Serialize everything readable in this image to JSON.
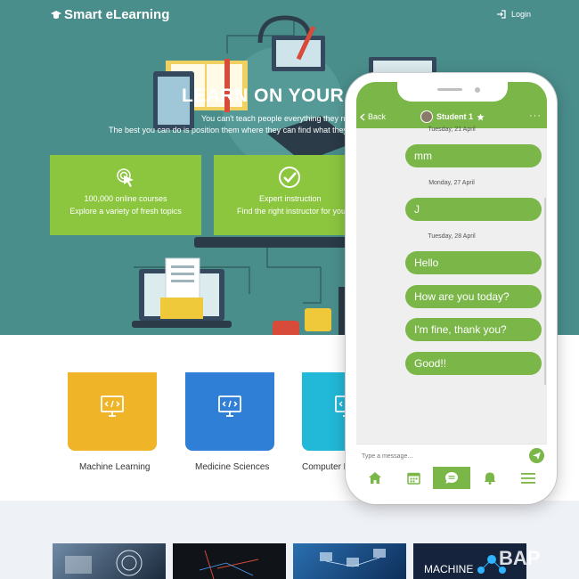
{
  "brand": {
    "name": "Smart eLearning"
  },
  "header": {
    "login_label": "Login"
  },
  "hero": {
    "title": "LEARN ON YOUR SCH",
    "subtitle_line1": "You can't teach people everything they need",
    "subtitle_line2": "The best you can do is position them where they can find what they nee",
    "features": [
      {
        "line1": "100,000 online courses",
        "line2": "Explore a variety of fresh topics",
        "icon": "pointer-click-icon"
      },
      {
        "line1": "Expert instruction",
        "line2": "Find the right instructor for you",
        "icon": "checkmark-circle-icon"
      }
    ]
  },
  "categories": [
    {
      "label": "Machine Learning",
      "color": "#f0b429",
      "icon": "code-monitor-icon"
    },
    {
      "label": "Medicine Sciences",
      "color": "#2f7fd6",
      "icon": "code-monitor-icon"
    },
    {
      "label": "Computer P",
      "color": "#22b8d8",
      "icon": "code-monitor-icon"
    }
  ],
  "thumbnails": [
    {
      "caption": ""
    },
    {
      "caption": ""
    },
    {
      "caption": ""
    },
    {
      "caption": "MACHINE"
    }
  ],
  "watermark": "BAP",
  "chat": {
    "back_label": "Back",
    "contact_name": "Student 1",
    "more_icon": "more-dots-icon",
    "partial_date": "Tuesday, 21 April",
    "messages": [
      {
        "date": "",
        "text": "mm"
      },
      {
        "date": "Monday, 27 April",
        "text": "J"
      },
      {
        "date": "Tuesday, 28 April",
        "text": "Hello"
      },
      {
        "date": "",
        "text": "How are you today?"
      },
      {
        "date": "",
        "text": "I'm fine, thank you?"
      },
      {
        "date": "",
        "text": "Good!!"
      }
    ],
    "composer_placeholder": "Type a message...",
    "tabs": [
      "home-icon",
      "calendar-icon",
      "chat-icon",
      "bell-icon",
      "menu-icon"
    ],
    "active_tab": 2
  },
  "colors": {
    "hero_bg": "#4a8e8c",
    "feature_green": "#8cc63f",
    "chat_green": "#7ab648"
  }
}
